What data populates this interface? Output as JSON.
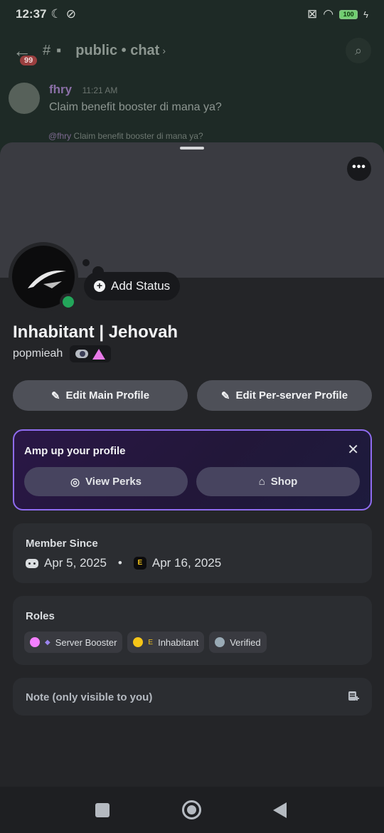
{
  "statusbar": {
    "time": "12:37",
    "battery": "100"
  },
  "background": {
    "unread_count": "99",
    "channel": "public • chat",
    "message": {
      "author": "fhry",
      "time": "11:21 AM",
      "text": "Claim benefit booster di mana ya?"
    },
    "reply_ref": {
      "author": "@fhry",
      "text": "Claim benefit booster di mana ya?"
    }
  },
  "profile": {
    "add_status": "Add Status",
    "display_name": "Inhabitant | Jehovah",
    "username": "popmieah",
    "edit_main": "Edit Main Profile",
    "edit_server": "Edit Per-server Profile"
  },
  "amp": {
    "title": "Amp up your profile",
    "perks": "View Perks",
    "shop": "Shop"
  },
  "member_since": {
    "title": "Member Since",
    "discord_date": "Apr 5, 2025",
    "server_date": "Apr 16, 2025",
    "separator": "•"
  },
  "roles": {
    "title": "Roles",
    "items": [
      {
        "name": "Server Booster",
        "color": "#f47fff"
      },
      {
        "name": "Inhabitant",
        "color": "#f5c518"
      },
      {
        "name": "Verified",
        "color": "#99aab5"
      }
    ]
  },
  "note": {
    "placeholder": "Note (only visible to you)"
  }
}
